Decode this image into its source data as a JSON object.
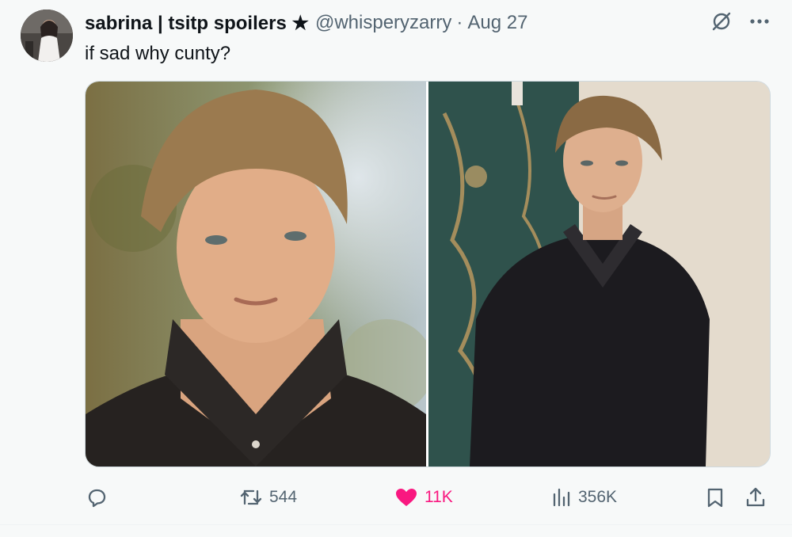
{
  "tweet": {
    "author_name": "sabrina | tsitp spoilers ★",
    "handle": "@whisperyzarry",
    "separator": "·",
    "date": "Aug 27",
    "text": "if sad why cunty?"
  },
  "header_icons": [
    "grok-icon",
    "more-options-icon"
  ],
  "media": {
    "count": 2,
    "items": [
      "left-photo-closeup-portrait",
      "right-photo-standing-portrait"
    ]
  },
  "actions": {
    "reply_count": "",
    "retweet_count": "544",
    "like_count": "11K",
    "views_count": "356K"
  },
  "colors": {
    "secondary_text": "#536471",
    "primary_text": "#0f1419",
    "like_pink": "#f91880",
    "border": "#cfd9de",
    "background": "#f7f9f9"
  }
}
